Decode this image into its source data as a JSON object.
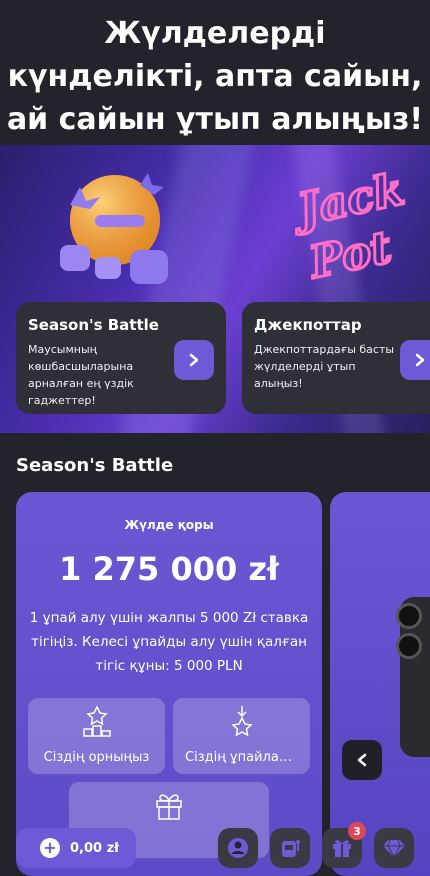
{
  "hero": {
    "title": "Жүлделерді күнделікті, апта сайын, ай сайын ұтып алыңыз!"
  },
  "promos": [
    {
      "title": "Season's Battle",
      "text": "Маусымның көшбасшыларына арналған ең үздік гаджеттер!"
    },
    {
      "title": "Джекпоттар",
      "text": "Джекпоттардағы басты жүлделерді ұтып алыңыз!"
    }
  ],
  "jackpot_art_text": "Jack Pot",
  "section": {
    "title": "Season's Battle"
  },
  "battle": {
    "label": "Жүлде қоры",
    "amount": "1 275 000 zł",
    "description": "1 ұпай алу үшін жалпы 5 000 Zł ставка тігіңіз. Келесі ұпайды алу үшін қалған тігіс құны: 5 000 PLN",
    "tiles": [
      {
        "label": "Сіздің орныңыз",
        "icon": "podium-star-icon"
      },
      {
        "label": "Сіздің ұпайларыңыз",
        "icon": "star-arrow-icon"
      },
      {
        "label": "",
        "icon": "gift-icon"
      }
    ]
  },
  "bottom_bar": {
    "balance": "0,00 zł",
    "gift_badge": "3",
    "icons": [
      "user-icon",
      "slot-machine-icon",
      "gift-icon",
      "diamond-icon"
    ]
  },
  "colors": {
    "accent": "#6c5ad6",
    "background": "#23232b",
    "card": "#2f2f38",
    "badge": "#e0475a"
  }
}
